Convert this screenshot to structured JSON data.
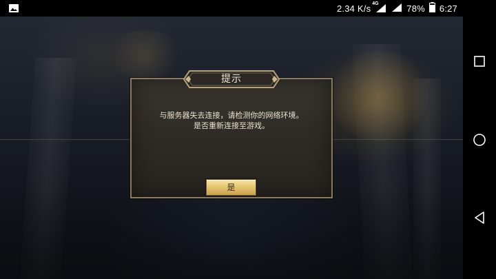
{
  "status_bar": {
    "network_speed": "2.34 K/s",
    "network_type": "4G",
    "battery_percent": "78%",
    "time": "6:27",
    "left_icon": "image-icon",
    "icons": [
      "mobile-signal-icon",
      "wifi-signal-icon",
      "battery-icon"
    ]
  },
  "dialog": {
    "title": "提示",
    "message_line1": "与服务器失去连接，请检测你的网络环境。",
    "message_line2": "是否重新连接至游戏。",
    "confirm_label": "是"
  },
  "nav_bar": {
    "buttons": [
      "recent-apps-icon",
      "home-icon",
      "back-icon"
    ]
  },
  "colors": {
    "dialog_border": "#8b7b5c",
    "dialog_bg": "#2e2b26",
    "button_gold": "#e6c774",
    "title_plate": "#2b2824"
  }
}
